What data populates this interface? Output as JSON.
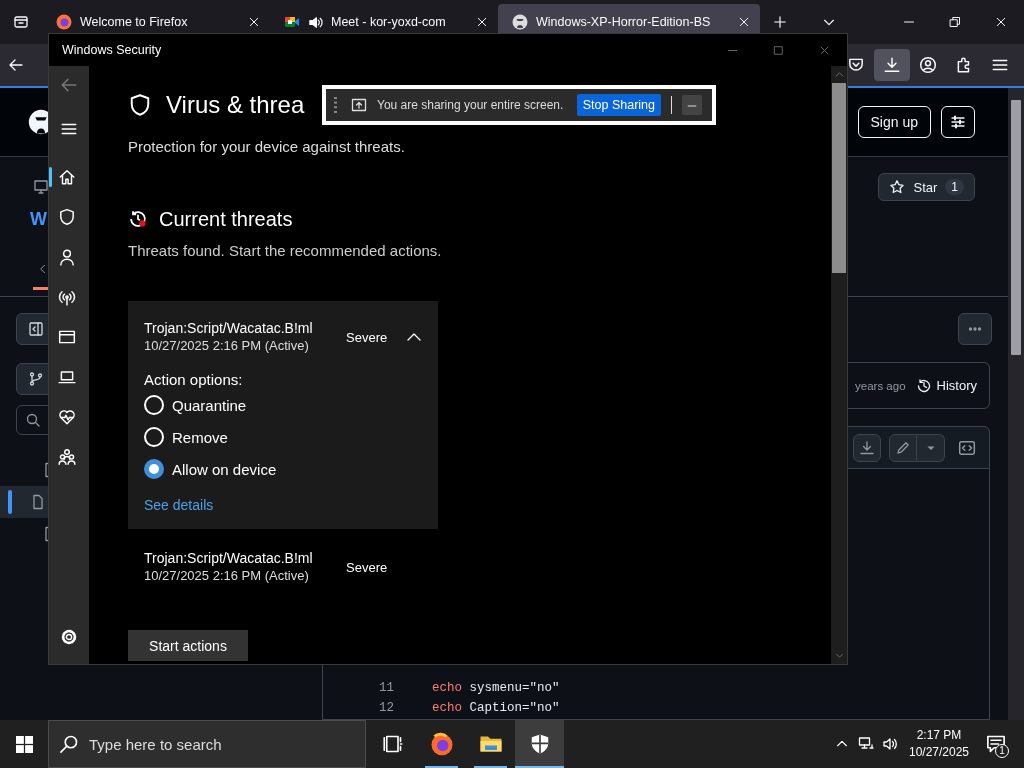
{
  "browser": {
    "tabs": [
      {
        "kind": "firefox",
        "title": "Welcome to Firefox",
        "audio": false,
        "selected": false
      },
      {
        "kind": "meet",
        "title": "Meet - kor-yoxd-com",
        "audio": true,
        "selected": false
      },
      {
        "kind": "github",
        "title": "Windows-XP-Horror-Edition-BS",
        "audio": false,
        "selected": true
      }
    ],
    "page": {
      "repo_name": "W",
      "sign_up": "Sign up",
      "star_label": "Star",
      "star_count": "1",
      "commit_age": "years ago",
      "history": "History",
      "code_lines": [
        {
          "number": "11",
          "code": "echo sysmenu=\"no\""
        },
        {
          "number": "12",
          "code": "echo Caption=\"no\""
        }
      ]
    }
  },
  "security": {
    "title": "Windows Security",
    "back": {
      "disabled": true
    },
    "nav": [
      {
        "kind": "home",
        "selected": true
      },
      {
        "kind": "shield",
        "selected": false
      },
      {
        "kind": "account",
        "selected": false
      },
      {
        "kind": "network",
        "selected": false
      },
      {
        "kind": "app",
        "selected": false
      },
      {
        "kind": "device",
        "selected": false
      },
      {
        "kind": "health",
        "selected": false
      },
      {
        "kind": "family",
        "selected": false
      }
    ],
    "page_title": "Virus & threa",
    "page_subtitle": "Protection for your device against threats.",
    "section_title": "Current threats",
    "section_text": "Threats found. Start the recommended actions.",
    "threats": [
      {
        "name": "Trojan:Script/Wacatac.B!ml",
        "date": "10/27/2025 2:16 PM (Active)",
        "severity": "Severe",
        "expanded": true,
        "options_label": "Action options:",
        "options": [
          {
            "label": "Quarantine",
            "selected": false
          },
          {
            "label": "Remove",
            "selected": false
          },
          {
            "label": "Allow on device",
            "selected": true
          }
        ],
        "link": "See details"
      },
      {
        "name": "Trojan:Script/Wacatac.B!ml",
        "date": "10/27/2025 2:16 PM (Active)",
        "severity": "Severe",
        "expanded": false
      }
    ],
    "start_button": "Start actions"
  },
  "sharing_bar": {
    "message": "You are sharing your entire screen.",
    "button": "Stop Sharing"
  },
  "taskbar": {
    "search_placeholder": "Type here to search",
    "apps": [
      {
        "kind": "taskview",
        "running": false,
        "selected": false
      },
      {
        "kind": "browser",
        "running": true,
        "selected": false
      },
      {
        "kind": "files",
        "running": true,
        "selected": false
      },
      {
        "kind": "security",
        "running": true,
        "selected": true
      }
    ],
    "time": "2:17 PM",
    "date": "10/27/2025",
    "notification_count": "1"
  }
}
